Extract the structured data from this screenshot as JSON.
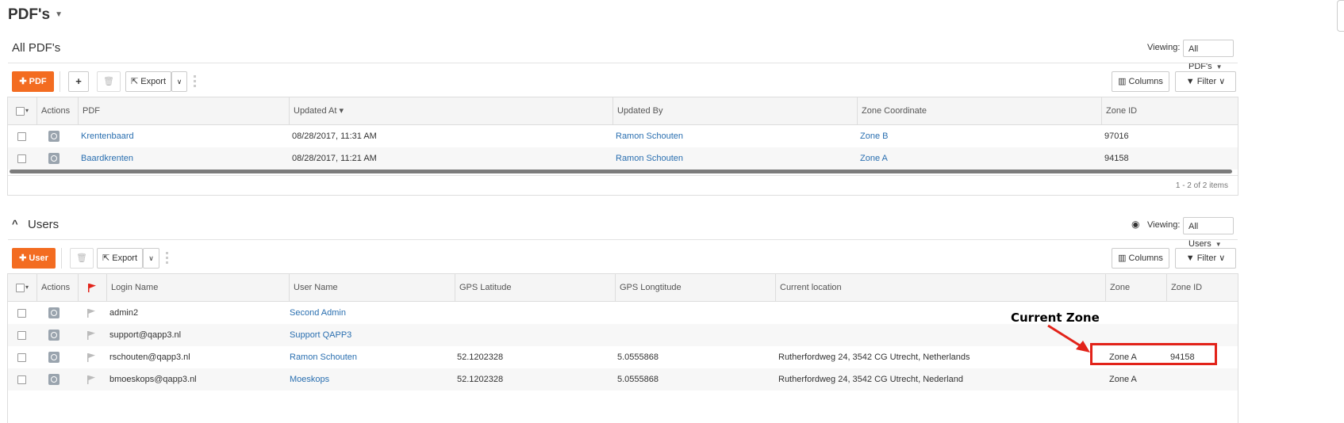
{
  "page": {
    "title": "PDF's"
  },
  "pdf_section": {
    "title": "All PDF's",
    "viewing_label": "Viewing:",
    "viewing_value": "All PDF's",
    "add_button": "PDF",
    "export_label": "Export",
    "columns_label": "Columns",
    "filter_label": "Filter",
    "columns": [
      "Actions",
      "PDF",
      "Updated At ▾",
      "Updated By",
      "Zone Coordinate",
      "Zone ID"
    ],
    "rows": [
      {
        "pdf": "Krentenbaard",
        "updated_at": "08/28/2017, 11:31 AM",
        "updated_by": "Ramon Schouten",
        "zone_coordinate": "Zone B",
        "zone_id": "97016"
      },
      {
        "pdf": "Baardkrenten",
        "updated_at": "08/28/2017, 11:21 AM",
        "updated_by": "Ramon Schouten",
        "zone_coordinate": "Zone A",
        "zone_id": "94158"
      }
    ],
    "pager": "1 - 2 of 2 items"
  },
  "users_section": {
    "title": "Users",
    "viewing_label": "Viewing:",
    "viewing_value": "All Users",
    "add_button": "User",
    "export_label": "Export",
    "columns_label": "Columns",
    "filter_label": "Filter",
    "columns": [
      "Actions",
      "Login Name",
      "User Name",
      "GPS Latitude",
      "GPS Longtitude",
      "Current location",
      "Zone",
      "Zone ID"
    ],
    "rows": [
      {
        "login": "admin2",
        "user_name": "Second Admin",
        "lat": "",
        "lng": "",
        "location": "",
        "zone": "",
        "zone_id": ""
      },
      {
        "login": "support@qapp3.nl",
        "user_name": "Support QAPP3",
        "lat": "",
        "lng": "",
        "location": "",
        "zone": "",
        "zone_id": ""
      },
      {
        "login": "rschouten@qapp3.nl",
        "user_name": "Ramon Schouten",
        "lat": "52.1202328",
        "lng": "5.0555868",
        "location": "Rutherfordweg 24, 3542 CG Utrecht, Netherlands",
        "zone": "Zone A",
        "zone_id": "94158"
      },
      {
        "login": "bmoeskops@qapp3.nl",
        "user_name": "Moeskops",
        "lat": "52.1202328",
        "lng": "5.0555868",
        "location": "Rutherfordweg 24, 3542 CG Utrecht, Nederland",
        "zone": "Zone A",
        "zone_id": ""
      }
    ]
  },
  "annotation": {
    "label": "Current Zone",
    "color": "#e2231a"
  },
  "colors": {
    "accent": "#f36c21",
    "link": "#2a6fb0",
    "flag": "#e2231a"
  }
}
